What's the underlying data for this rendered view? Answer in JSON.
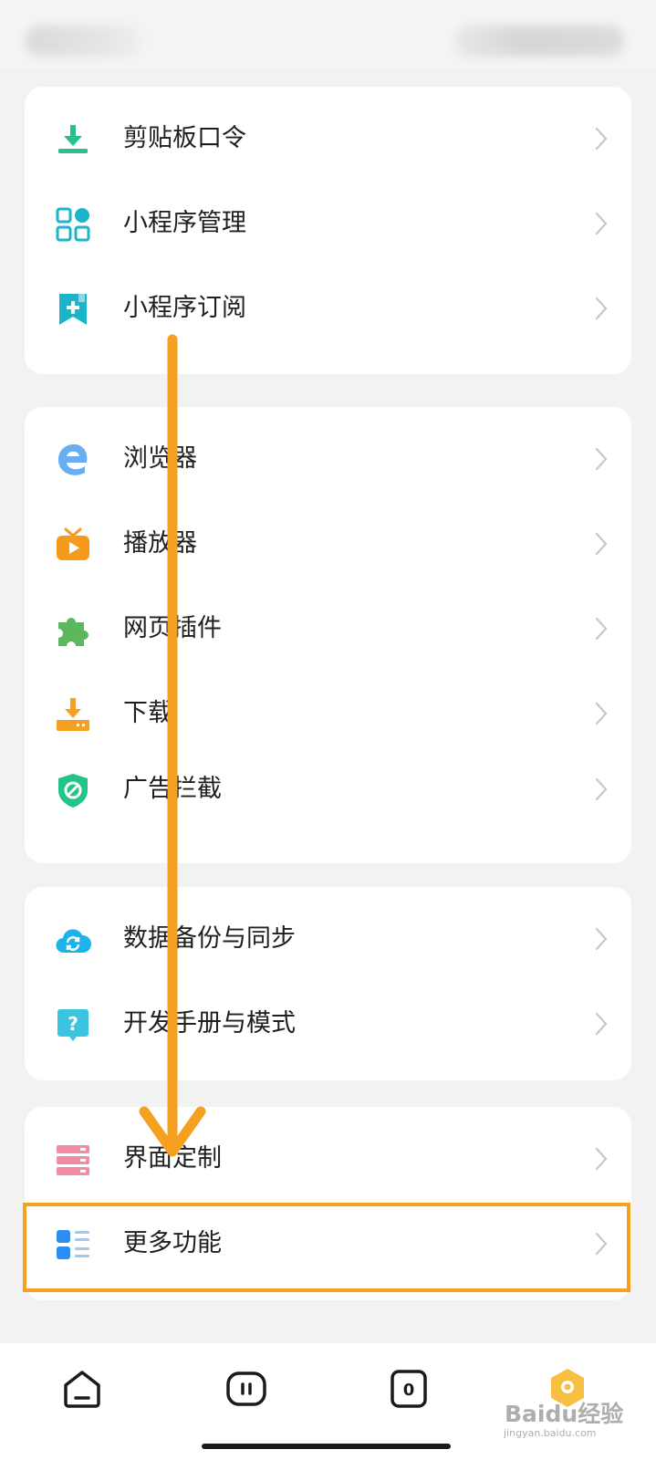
{
  "sections": [
    {
      "items": [
        {
          "label": "剪贴板口令",
          "icon": "download-clipboard-icon",
          "color": "#22c48a"
        },
        {
          "label": "小程序管理",
          "icon": "grid-apps-icon",
          "color": "#1cb4c9"
        },
        {
          "label": "小程序订阅",
          "icon": "bookmark-plus-icon",
          "color": "#1cb4c9"
        }
      ]
    },
    {
      "items": [
        {
          "label": "浏览器",
          "icon": "browser-e-icon",
          "color": "#6aaef2"
        },
        {
          "label": "播放器",
          "icon": "tv-play-icon",
          "color": "#f59a1c"
        },
        {
          "label": "网页插件",
          "icon": "puzzle-icon",
          "color": "#5cb85c"
        },
        {
          "label": "下载",
          "icon": "download-tray-icon",
          "color": "#f5a020"
        },
        {
          "label": "广告拦截",
          "icon": "shield-block-icon",
          "color": "#22c48a"
        }
      ]
    },
    {
      "items": [
        {
          "label": "数据备份与同步",
          "icon": "cloud-sync-icon",
          "color": "#1cb4e8"
        },
        {
          "label": "开发手册与模式",
          "icon": "help-bubble-icon",
          "color": "#3ac4e0"
        }
      ]
    },
    {
      "items": [
        {
          "label": "界面定制",
          "icon": "layout-customize-icon",
          "color": "#f28aa4"
        },
        {
          "label": "更多功能",
          "icon": "more-features-icon",
          "color": "#2c8ef5"
        }
      ]
    }
  ],
  "tabs": [
    {
      "name": "home",
      "icon": "home-icon"
    },
    {
      "name": "tabs",
      "icon": "tab-switch-icon",
      "badge": "II"
    },
    {
      "name": "windows",
      "icon": "window-count-icon",
      "count": "0"
    },
    {
      "name": "profile",
      "icon": "profile-icon"
    }
  ],
  "colors": {
    "annotation": "#f5a020",
    "background": "#f2f2f2",
    "card": "#ffffff"
  },
  "watermark": {
    "text": "Baidu经验",
    "url": "jingyan.baidu.com"
  }
}
